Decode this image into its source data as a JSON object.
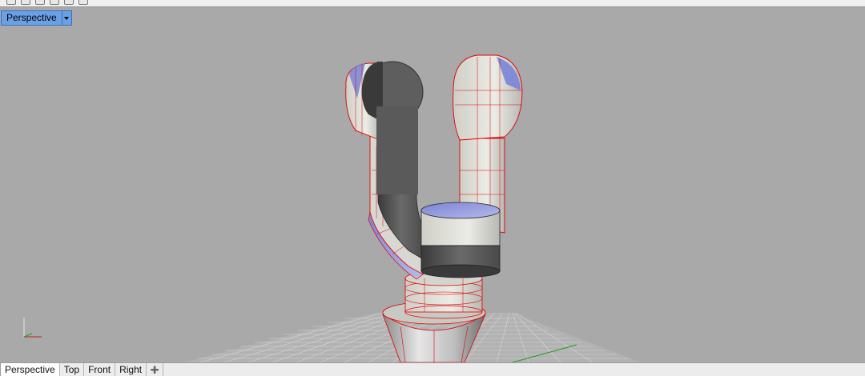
{
  "viewport": {
    "title": "Perspective"
  },
  "tabs": [
    {
      "label": "Perspective",
      "active": true
    },
    {
      "label": "Top",
      "active": false
    },
    {
      "label": "Front",
      "active": false
    },
    {
      "label": "Right",
      "active": false
    }
  ],
  "add_tab_icon": "plus-icon",
  "colors": {
    "viewport_bg": "#a9a9a9",
    "active_viewport_title": "#6aa0e6",
    "selection_edges": "#e00000",
    "grid_lines": "#d8d8d8",
    "x_axis": "#c02020",
    "y_axis": "#20a020"
  }
}
